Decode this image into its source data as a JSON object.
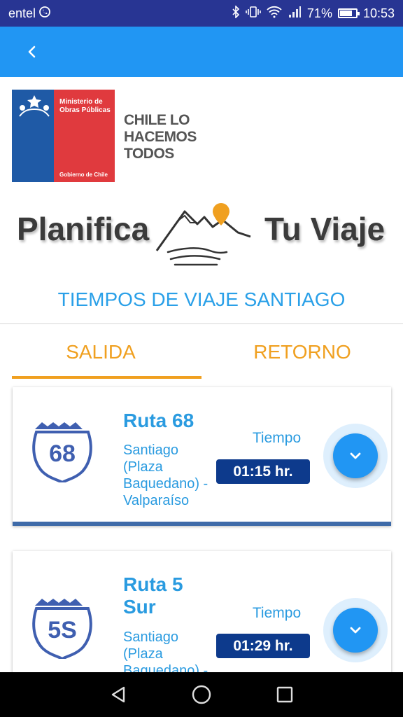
{
  "status_bar": {
    "carrier": "entel",
    "battery_percent": "71%",
    "battery_level": 0.71,
    "time": "10:53",
    "icons": [
      "whatsapp-icon",
      "bluetooth-icon",
      "vibrate-icon",
      "wifi-icon",
      "signal-icon",
      "battery-icon"
    ]
  },
  "app_bar": {
    "back_icon": "chevron-left-icon",
    "color": "#2196f3"
  },
  "header": {
    "ministry_line1": "Ministerio de",
    "ministry_line2": "Obras Públicas",
    "government": "Gobierno de Chile",
    "slogan_line1": "CHILE LO",
    "slogan_line2": "HACEMOS",
    "slogan_line3": "TODOS",
    "plan_left": "Planifica",
    "plan_right": "Tu Viaje"
  },
  "section_title": "TIEMPOS DE VIAJE SANTIAGO",
  "tabs": [
    {
      "label": "SALIDA",
      "active": true
    },
    {
      "label": "RETORNO",
      "active": false
    }
  ],
  "routes": [
    {
      "shield_number": "68",
      "name": "Ruta 68",
      "desc_lines": [
        "Santiago",
        "(Plaza",
        "Baquedano) -",
        "Valparaíso"
      ],
      "time_label": "Tiempo",
      "time_value": "01:15 hr."
    },
    {
      "shield_number": "5S",
      "name_lines": [
        "Ruta 5",
        "Sur"
      ],
      "desc_lines": [
        "Santiago",
        "(Plaza",
        "Baquedano) -"
      ],
      "time_label": "Tiempo",
      "time_value": "01:29 hr."
    }
  ],
  "nav_bar": {
    "icons": [
      "back-triangle-icon",
      "home-circle-icon",
      "recents-square-icon"
    ]
  },
  "colors": {
    "status_bar": "#283593",
    "accent": "#f0a020",
    "route_text": "#2a9be0",
    "time_badge": "#0d3a8c"
  }
}
